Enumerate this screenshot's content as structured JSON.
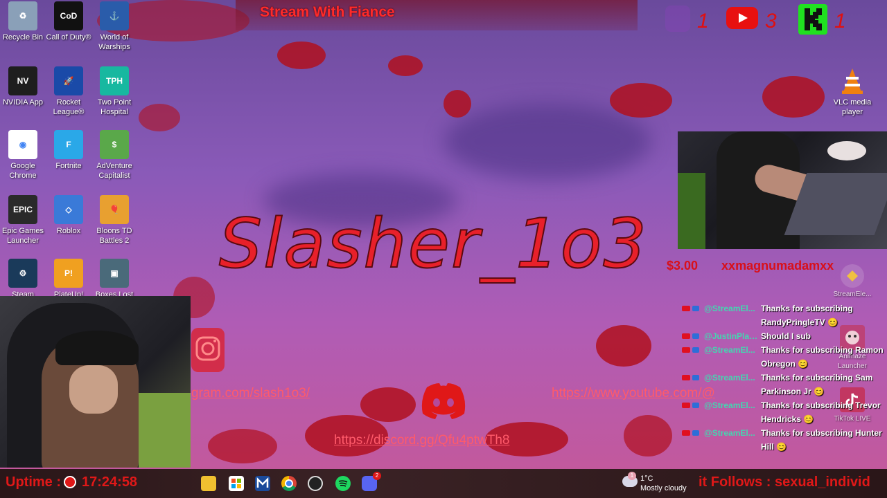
{
  "stream_title": "Stream With Fiance",
  "channel_name": "Slasher_1o3",
  "desktop_icons": [
    {
      "label": "Recycle Bin",
      "color": "#8aa0b8",
      "glyph": "♻"
    },
    {
      "label": "Call of Duty®",
      "color": "#111111",
      "glyph": "CoD"
    },
    {
      "label": "World of Warships",
      "color": "#2a5caa",
      "glyph": "⚓"
    },
    {
      "label": "NVIDIA App",
      "color": "#1e1e1e",
      "glyph": "NV"
    },
    {
      "label": "Rocket League®",
      "color": "#1a4aa8",
      "glyph": "🚀"
    },
    {
      "label": "Two Point Hospital",
      "color": "#18b8a0",
      "glyph": "TPH"
    },
    {
      "label": "Google Chrome",
      "color": "#ffffff",
      "glyph": "◉"
    },
    {
      "label": "Fortnite",
      "color": "#2aa8e8",
      "glyph": "F"
    },
    {
      "label": "AdVenture Capitalist",
      "color": "#5aa84a",
      "glyph": "$"
    },
    {
      "label": "Epic Games Launcher",
      "color": "#2a2a2a",
      "glyph": "EPIC"
    },
    {
      "label": "Roblox",
      "color": "#3a7ad8",
      "glyph": "◇"
    },
    {
      "label": "Bloons TD Battles 2",
      "color": "#e8a030",
      "glyph": "🎈"
    },
    {
      "label": "Steam",
      "color": "#1a3a5a",
      "glyph": "⚙"
    },
    {
      "label": "PlateUp!",
      "color": "#f0a020",
      "glyph": "P!"
    },
    {
      "label": "Boxes Lost",
      "color": "#4a6a7a",
      "glyph": "▣"
    }
  ],
  "right_icons": {
    "vlc_label": "VLC media player",
    "streamelements_label": "StreamEle...",
    "animaze_label": "Animaze Launcher",
    "tiktok_label": "TikTok LIVE"
  },
  "social": {
    "twitch_count": "1",
    "youtube_count": "3",
    "kick_count": "1"
  },
  "tip_ticker": {
    "amount": "$3.00",
    "name": "xxmagnumadamxx"
  },
  "links": {
    "instagram": "gram.com/slash1o3/",
    "discord": "https://discord.gg/Qfu4ptwTh8",
    "youtube": "https://www.youtube.com/@"
  },
  "chat": [
    {
      "user": "@StreamEl...",
      "text": "Thanks for subscribing RandyPringleTV 😊"
    },
    {
      "user": "@JustinPlays...",
      "text": "Should I sub"
    },
    {
      "user": "@StreamEl...",
      "text": "Thanks for subscribing Ramon Obregon 😊"
    },
    {
      "user": "@StreamEl...",
      "text": "Thanks for subscribing Sam Parkinson Jr 😊"
    },
    {
      "user": "@StreamEl...",
      "text": "Thanks for subscribing Trevor Hendricks 😊"
    },
    {
      "user": "@StreamEl...",
      "text": "Thanks for subscribing Hunter Hill 😊"
    }
  ],
  "taskbar": {
    "uptime_label": "Uptime :",
    "uptime_value": "17:24:58",
    "weather_temp": "1°C",
    "weather_cond": "Mostly cloudy",
    "weather_badge": "1",
    "follow_ticker": "it Follows : sexual_individ",
    "discord_badge": "2"
  },
  "colors": {
    "accent_red": "#e01818",
    "chat_user": "#44d6b0"
  }
}
